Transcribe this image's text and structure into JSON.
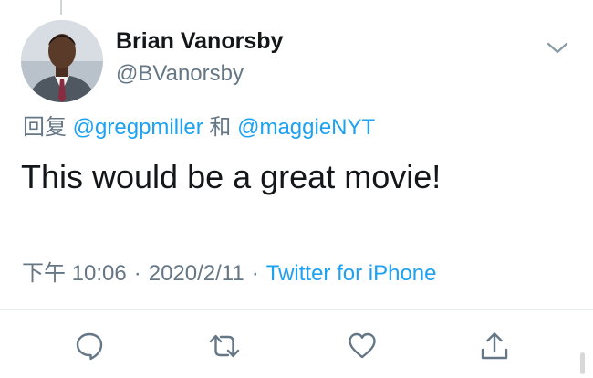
{
  "tweet": {
    "author_name": "Brian Vanorsby",
    "author_handle": "@BVanorsby",
    "reply_prefix": "回复 ",
    "reply_to_1": "@gregpmiller",
    "reply_joiner": " 和 ",
    "reply_to_2": "@maggieNYT",
    "text": "This would be a great movie!",
    "time": "下午 10:06",
    "separator": "·",
    "date": "2020/2/11",
    "source": "Twitter for iPhone"
  },
  "icons": [
    "chevron-down-icon",
    "reply-icon",
    "retweet-icon",
    "like-icon",
    "share-icon"
  ],
  "colors": {
    "link": "#1da1f2",
    "secondary_text": "#657786",
    "primary_text": "#14171a"
  }
}
